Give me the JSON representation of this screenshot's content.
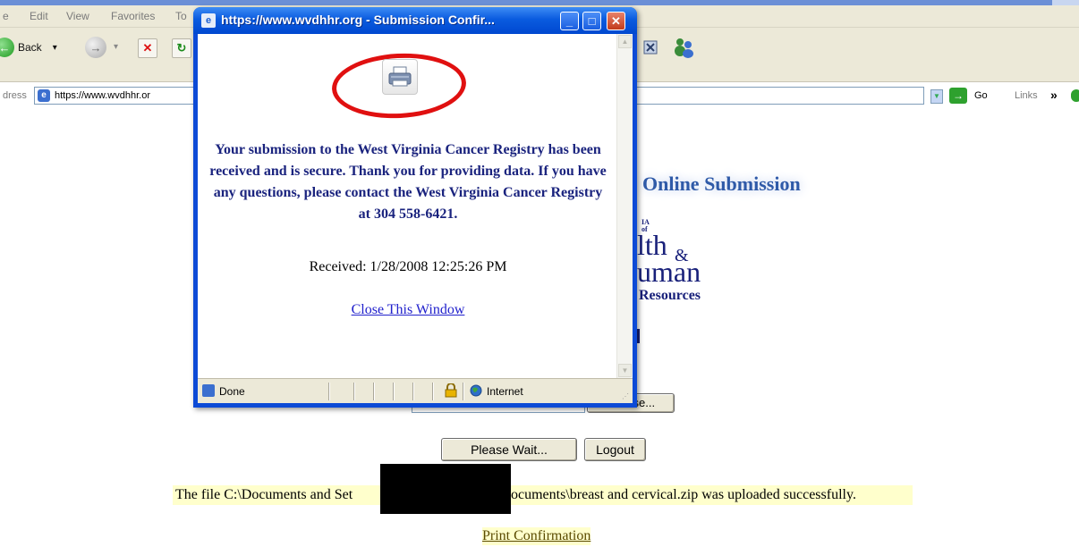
{
  "browser": {
    "menu_items": [
      "e",
      "Edit",
      "View",
      "Favorites",
      "To"
    ],
    "toolbar": {
      "back_label": "Back",
      "back_dropdown": "▾"
    },
    "address": {
      "label": "dress",
      "url": "https://www.wvdhhr.or"
    },
    "go_label": "Go",
    "links_label": "Links",
    "links_chevron": "»"
  },
  "page": {
    "online_submission": "Online Submission",
    "logo_fragments": {
      "tiny": "IA\nof",
      "line1": "lth",
      "amp": "&",
      "line2": "uman",
      "line3": "Resources"
    },
    "browse_button": "Browse...",
    "please_wait_button": "Please Wait...",
    "logout_button": "Logout",
    "upload_msg_left": "The file C:\\Documents and Set",
    "upload_msg_right": "ocuments\\breast and cervical.zip was uploaded successfully.",
    "print_confirmation": "Print Confirmation"
  },
  "popup": {
    "title": "https://www.wvdhhr.org - Submission Confir...",
    "buttons": {
      "minimize": "_",
      "maximize": "□",
      "close": "✕"
    },
    "message": "Your submission to the West Virginia Cancer Registry has been received and is secure. Thank you for providing data. If you have any questions, please contact the West Virginia Cancer Registry at 304 558-6421.",
    "received": "Received: 1/28/2008 12:25:26 PM",
    "close_link": "Close This Window",
    "status": {
      "done": "Done",
      "zone": "Internet"
    }
  },
  "icons": {
    "printer": "printer-icon",
    "lock": "lock-icon",
    "globe": "globe-icon",
    "page": "ie-page-icon"
  },
  "colors": {
    "xp_blue": "#0c4ad6",
    "highlight_red": "#e01010",
    "message_text": "#1a237e",
    "link": "#2020cc",
    "highlight_yellow": "#ffffcc"
  }
}
